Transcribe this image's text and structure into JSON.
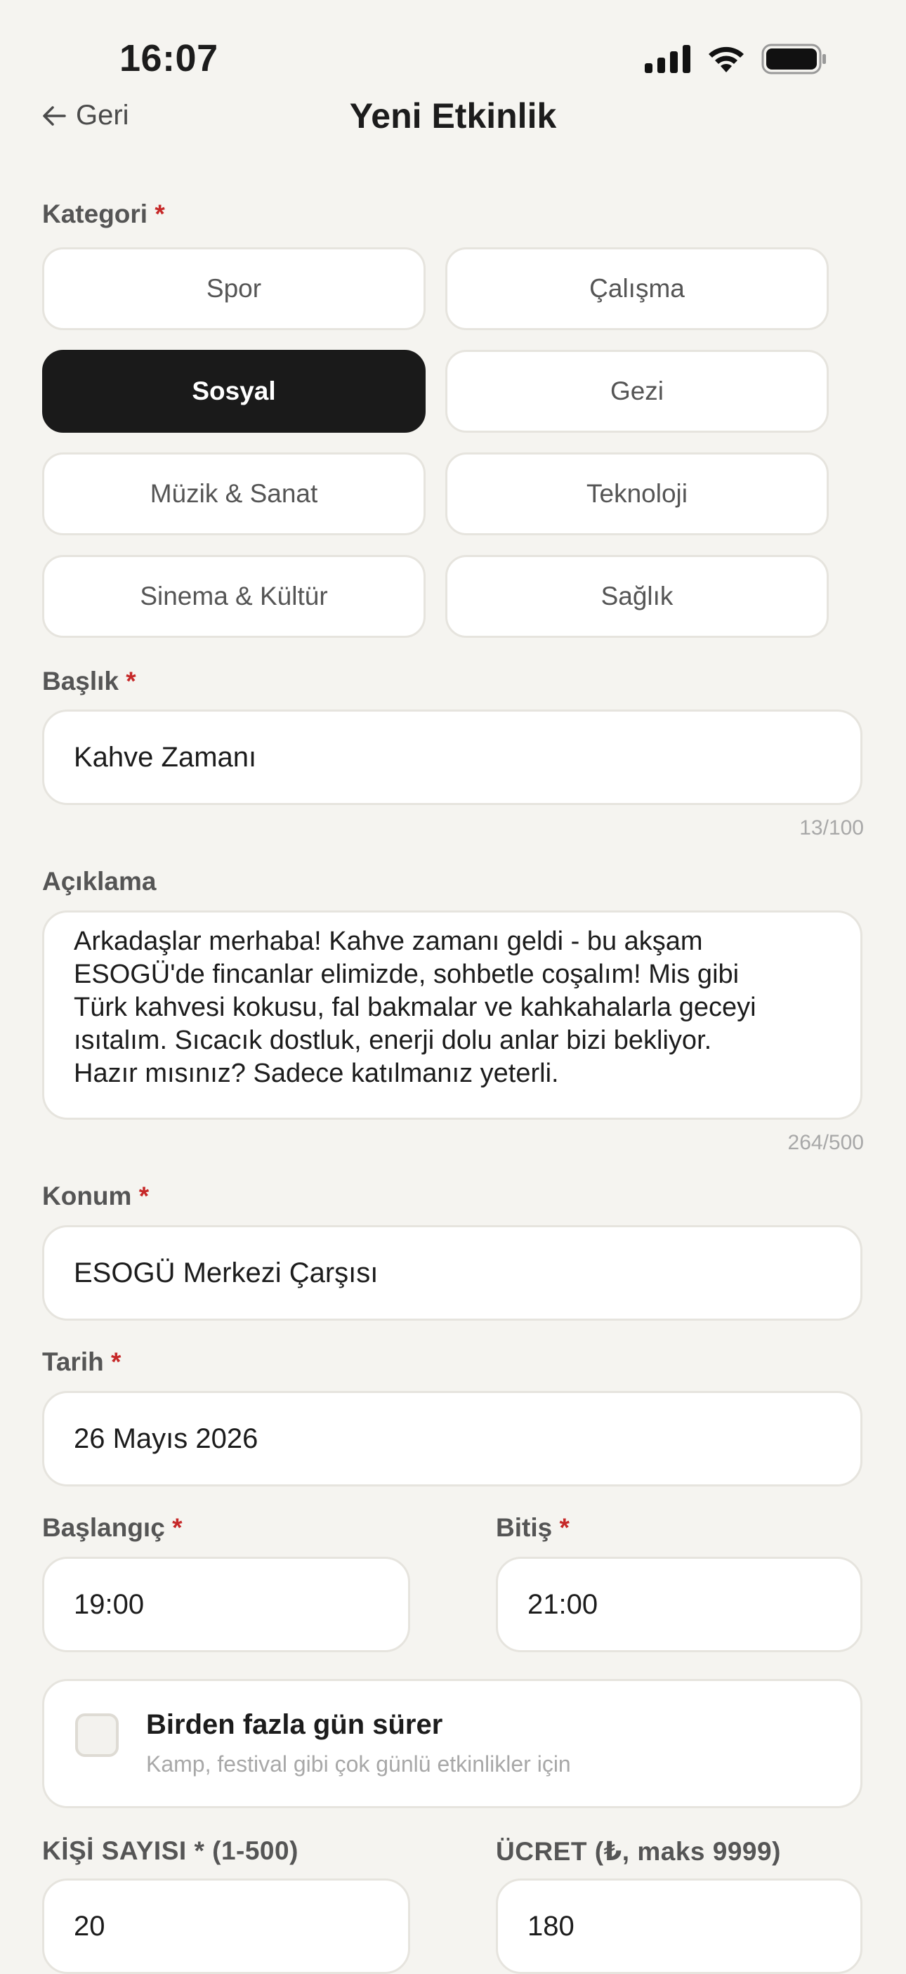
{
  "status": {
    "time": "16:07"
  },
  "nav": {
    "back_label": "Geri",
    "title": "Yeni Etkinlik"
  },
  "category": {
    "label": "Kategori",
    "required_mark": "*",
    "options": [
      "Spor",
      "Çalışma",
      "Sosyal",
      "Gezi",
      "Müzik & Sanat",
      "Teknoloji",
      "Sinema & Kültür",
      "Sağlık"
    ],
    "selected": "Sosyal"
  },
  "title_field": {
    "label": "Başlık",
    "required_mark": "*",
    "value": "Kahve Zamanı",
    "counter": "13/100"
  },
  "description": {
    "label": "Açıklama",
    "lines": [
      "Arkadaşlar merhaba! Kahve zamanı geldi - bu akşam",
      "ESOGÜ'de fincanlar elimizde, sohbetle coşalım! Mis gibi",
      "Türk kahvesi kokusu, fal bakmalar ve kahkahalarla geceyi",
      "ısıtalım. Sıcacık dostluk, enerji dolu anlar bizi bekliyor.",
      "Hazır mısınız? Sadece katılmanız yeterli."
    ],
    "counter": "264/500"
  },
  "location": {
    "label": "Konum",
    "required_mark": "*",
    "value": "ESOGÜ Merkezi Çarşısı"
  },
  "date": {
    "label": "Tarih",
    "required_mark": "*",
    "value": "26 Mayıs 2026"
  },
  "start": {
    "label": "Başlangıç",
    "required_mark": "*",
    "value": "19:00"
  },
  "end": {
    "label": "Bitiş",
    "required_mark": "*",
    "value": "21:00"
  },
  "multi_day": {
    "title": "Birden fazla gün sürer",
    "subtitle": "Kamp, festival gibi çok günlü etkinlikler için",
    "checked": false
  },
  "capacity": {
    "label": "KİŞİ SAYISI * (1-500)",
    "value": "20"
  },
  "price": {
    "label": "ÜCRET (₺, maks 9999)",
    "value": "180"
  },
  "colors": {
    "accent": "#1a1a1a",
    "required": "#c62828",
    "background": "#f5f4f0"
  }
}
